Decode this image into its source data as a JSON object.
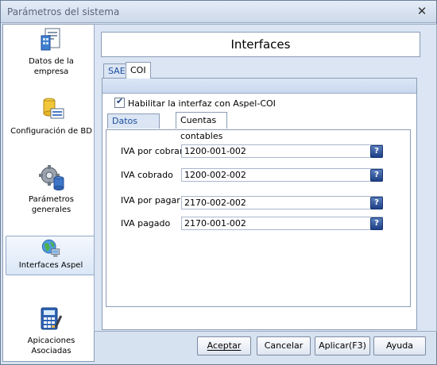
{
  "window": {
    "title": "Parámetros del sistema",
    "close_glyph": "✕"
  },
  "sidebar": {
    "items": [
      {
        "label": "Datos de la empresa",
        "icon": "document-building-icon"
      },
      {
        "label": "Configuración de BD",
        "icon": "database-icon"
      },
      {
        "label": "Parámetros generales",
        "icon": "gear-database-icon"
      },
      {
        "label": "Interfaces Aspel",
        "icon": "network-globe-icon",
        "selected": true
      },
      {
        "label": "Apicaciones Asociadas",
        "icon": "calculator-icon"
      }
    ]
  },
  "header": {
    "title": "Interfaces"
  },
  "outer_tabs": [
    {
      "label": "SAE",
      "active": false
    },
    {
      "label": "COI",
      "active": true
    }
  ],
  "coi": {
    "enable_label": "Habilitar la interfaz con Aspel-COI",
    "enable_checked": true,
    "inner_tabs": [
      {
        "label": "Datos generales",
        "active": false
      },
      {
        "label": "Cuentas contables",
        "active": true
      }
    ],
    "fields": [
      {
        "label": "IVA por cobrar",
        "value": "1200-001-002"
      },
      {
        "label": "IVA cobrado",
        "value": "1200-002-002"
      },
      {
        "label": "IVA por pagar",
        "value": "2170-002-002"
      },
      {
        "label": "IVA pagado",
        "value": "2170-001-002"
      }
    ],
    "help_glyph": "?"
  },
  "buttons": {
    "accept": "Aceptar",
    "cancel": "Cancelar",
    "apply": "Aplicar(F3)",
    "help": "Ayuda"
  },
  "colors": {
    "accent": "#1a4fa0",
    "frame": "#d7e2f1"
  }
}
